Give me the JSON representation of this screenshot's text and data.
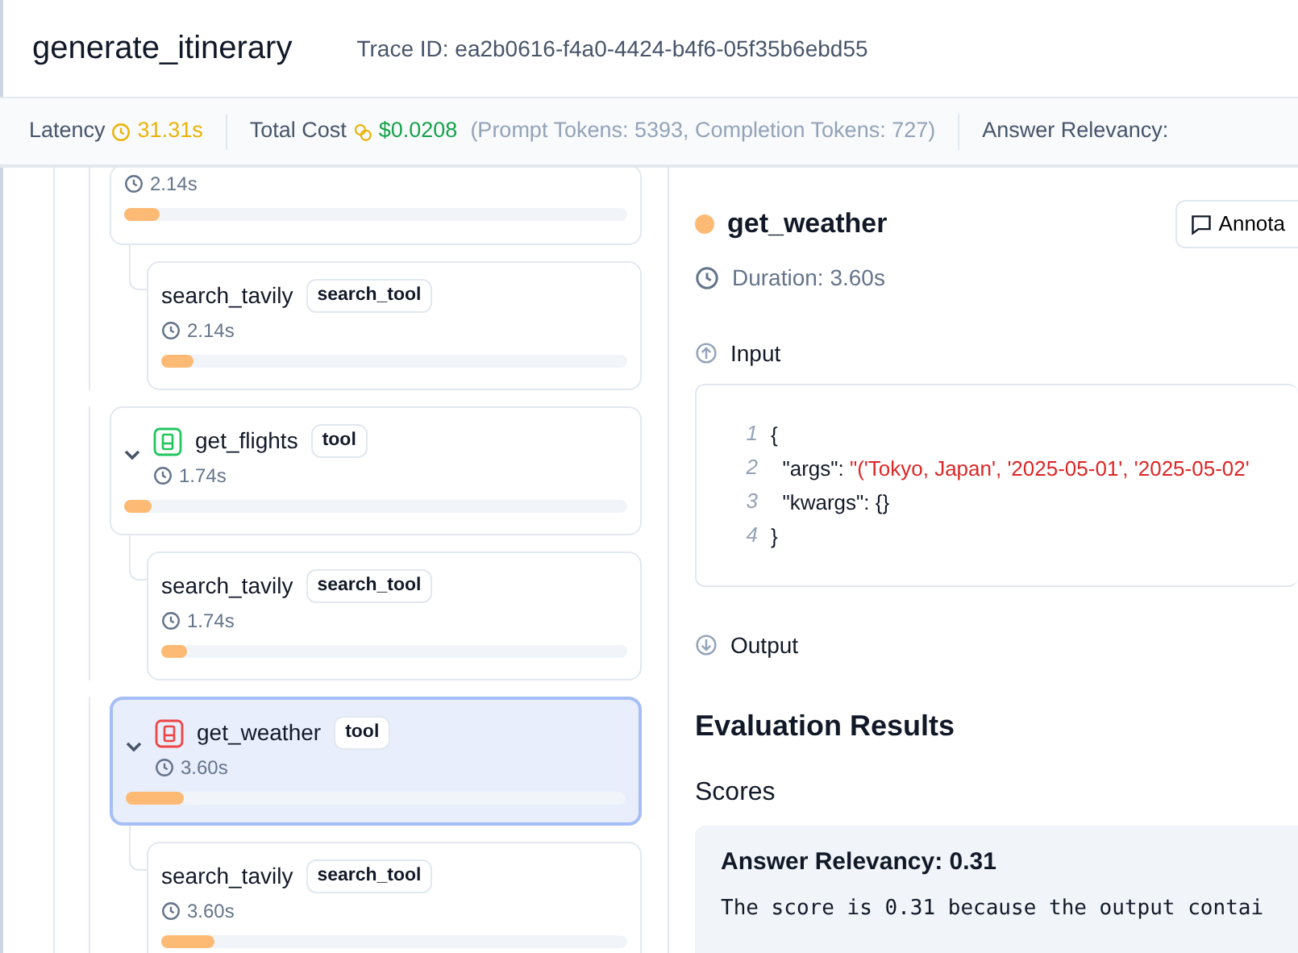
{
  "header": {
    "title": "generate_itinerary",
    "trace_id": "Trace ID: ea2b0616-f4a0-4424-b4f6-05f35b6ebd55"
  },
  "stats": {
    "latency_label": "Latency",
    "latency": "31.31s",
    "cost_label": "Total Cost",
    "cost": "$0.0208",
    "tokens": "(Prompt Tokens: 5393, Completion Tokens: 727)",
    "relevancy_label": "Answer Relevancy:"
  },
  "spans": [
    {
      "duration": "2.14s",
      "level": 0.07,
      "selected": false,
      "children": [
        {
          "name": "search_tavily",
          "tag": "search_tool",
          "duration": "2.14s",
          "level": 0.07
        }
      ]
    },
    {
      "name": "get_flights",
      "tag": "tool",
      "duration": "1.74s",
      "level": 0.055,
      "expanded": true,
      "selected": false,
      "color": "#22c55e",
      "children": [
        {
          "name": "search_tavily",
          "tag": "search_tool",
          "duration": "1.74s",
          "level": 0.055
        }
      ]
    },
    {
      "name": "get_weather",
      "tag": "tool",
      "duration": "3.60s",
      "level": 0.115,
      "expanded": true,
      "selected": true,
      "color": "#ef4444",
      "children": [
        {
          "name": "search_tavily",
          "tag": "search_tool",
          "duration": "3.60s",
          "level": 0.115
        }
      ]
    }
  ],
  "detail": {
    "title": "get_weather",
    "annotate": "Annota",
    "duration": "Duration: 3.60s",
    "input_label": "Input",
    "code_lines": [
      {
        "number": "1",
        "parts": [
          {
            "kind": "punct",
            "text": "{"
          }
        ]
      },
      {
        "number": "2",
        "parts": [
          {
            "kind": "key",
            "text": "  \"args\": "
          },
          {
            "kind": "string",
            "text": "\"('Tokyo, Japan', '2025-05-01', '2025-05-02'"
          }
        ]
      },
      {
        "number": "3",
        "parts": [
          {
            "kind": "key",
            "text": "  \"kwargs\": {}"
          }
        ]
      },
      {
        "number": "4",
        "parts": [
          {
            "kind": "punct",
            "text": "}"
          }
        ]
      }
    ],
    "output_label": "Output",
    "evaluation_heading": "Evaluation Results",
    "scores_heading": "Scores",
    "score": {
      "title": "Answer Relevancy: 0.31",
      "reason": "The score is 0.31 because the output contai"
    }
  }
}
